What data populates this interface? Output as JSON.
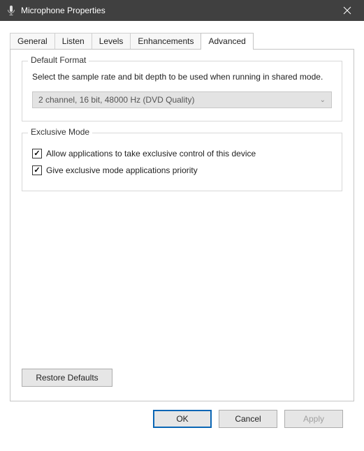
{
  "window": {
    "title": "Microphone Properties"
  },
  "tabs": {
    "items": [
      {
        "label": "General"
      },
      {
        "label": "Listen"
      },
      {
        "label": "Levels"
      },
      {
        "label": "Enhancements"
      },
      {
        "label": "Advanced"
      }
    ],
    "active_index": 4
  },
  "default_format": {
    "legend": "Default Format",
    "description": "Select the sample rate and bit depth to be used when running in shared mode.",
    "selected": "2 channel, 16 bit, 48000 Hz (DVD Quality)"
  },
  "exclusive_mode": {
    "legend": "Exclusive Mode",
    "opt1": {
      "label": "Allow applications to take exclusive control of this device",
      "checked": true
    },
    "opt2": {
      "label": "Give exclusive mode applications priority",
      "checked": true
    }
  },
  "buttons": {
    "restore": "Restore Defaults",
    "ok": "OK",
    "cancel": "Cancel",
    "apply": "Apply"
  }
}
